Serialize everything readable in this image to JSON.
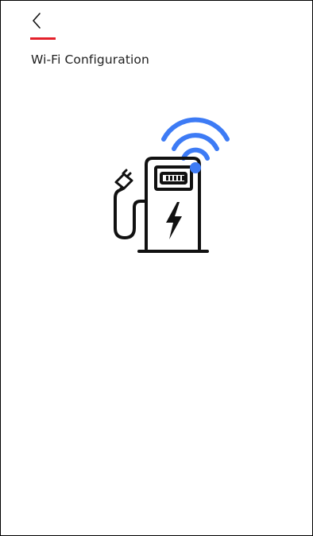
{
  "header": {
    "back_icon": "chevron-left-icon",
    "title": "Wi-Fi Configuration"
  },
  "illustration": {
    "icon": "ev-charger-wifi-icon",
    "wifi_icon": "wifi-signal-icon",
    "bolt_icon": "lightning-bolt-icon",
    "plug_icon": "charging-plug-icon"
  },
  "colors": {
    "accent": "#e4202a",
    "wifi": "#3d7bf5",
    "ink": "#111111",
    "title": "#1f1f1f",
    "background": "#ffffff"
  }
}
